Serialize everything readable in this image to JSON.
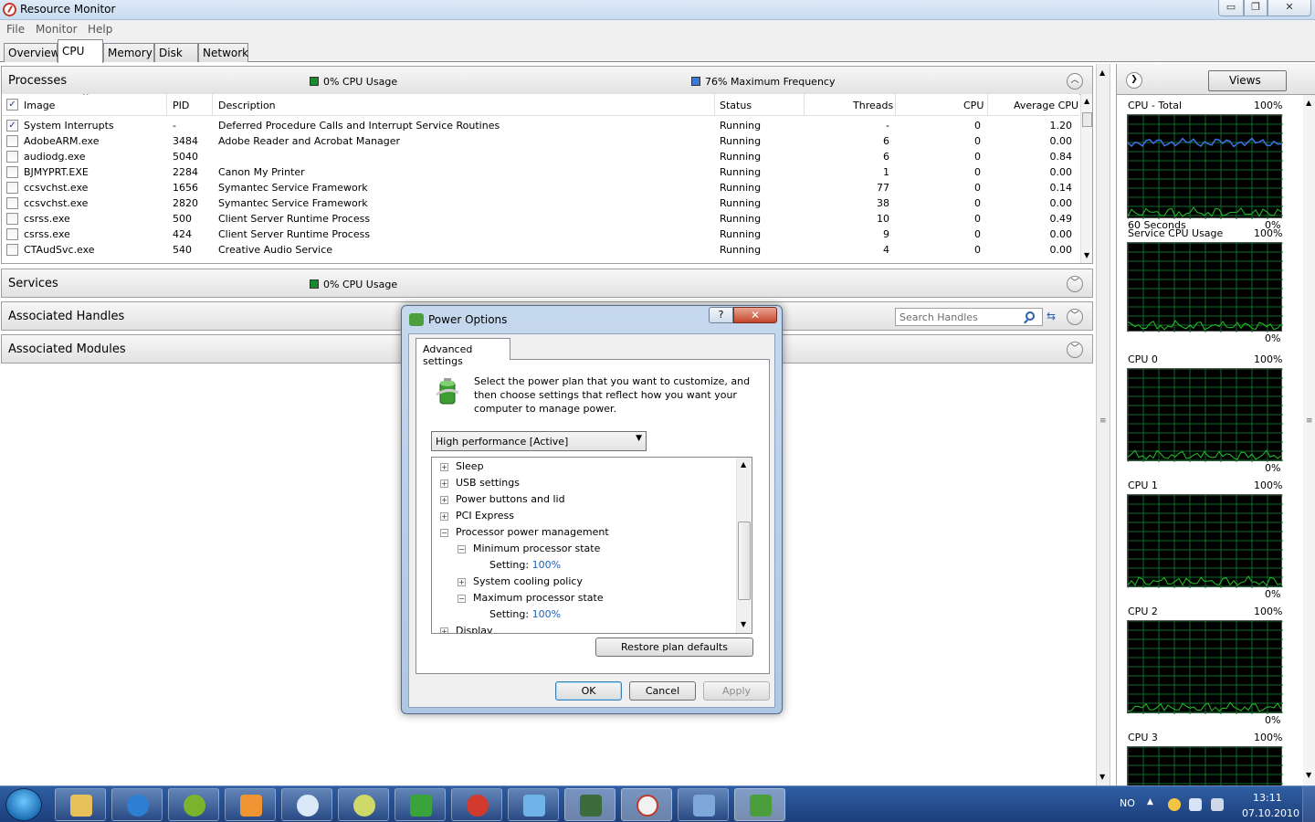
{
  "window": {
    "title": "Resource Monitor",
    "min": "▭",
    "max": "❐",
    "close": "✕"
  },
  "menu": [
    "File",
    "Monitor",
    "Help"
  ],
  "tabs": [
    "Overview",
    "CPU",
    "Memory",
    "Disk",
    "Network"
  ],
  "processes": {
    "title": "Processes",
    "cpu_usage": "0% CPU Usage",
    "max_freq": "76% Maximum Frequency",
    "columns": [
      "Image",
      "PID",
      "Description",
      "Status",
      "Threads",
      "CPU",
      "Average CPU"
    ],
    "rows": [
      {
        "checked": true,
        "image": "System Interrupts",
        "pid": "-",
        "desc": "Deferred Procedure Calls and Interrupt Service Routines",
        "status": "Running",
        "threads": "-",
        "cpu": "0",
        "avg": "1.20"
      },
      {
        "checked": false,
        "image": "AdobeARM.exe",
        "pid": "3484",
        "desc": "Adobe Reader and Acrobat Manager",
        "status": "Running",
        "threads": "6",
        "cpu": "0",
        "avg": "0.00"
      },
      {
        "checked": false,
        "image": "audiodg.exe",
        "pid": "5040",
        "desc": "",
        "status": "Running",
        "threads": "6",
        "cpu": "0",
        "avg": "0.84"
      },
      {
        "checked": false,
        "image": "BJMYPRT.EXE",
        "pid": "2284",
        "desc": "Canon My Printer",
        "status": "Running",
        "threads": "1",
        "cpu": "0",
        "avg": "0.00"
      },
      {
        "checked": false,
        "image": "ccsvchst.exe",
        "pid": "1656",
        "desc": "Symantec Service Framework",
        "status": "Running",
        "threads": "77",
        "cpu": "0",
        "avg": "0.14"
      },
      {
        "checked": false,
        "image": "ccsvchst.exe",
        "pid": "2820",
        "desc": "Symantec Service Framework",
        "status": "Running",
        "threads": "38",
        "cpu": "0",
        "avg": "0.00"
      },
      {
        "checked": false,
        "image": "csrss.exe",
        "pid": "500",
        "desc": "Client Server Runtime Process",
        "status": "Running",
        "threads": "10",
        "cpu": "0",
        "avg": "0.49"
      },
      {
        "checked": false,
        "image": "csrss.exe",
        "pid": "424",
        "desc": "Client Server Runtime Process",
        "status": "Running",
        "threads": "9",
        "cpu": "0",
        "avg": "0.00"
      },
      {
        "checked": false,
        "image": "CTAudSvc.exe",
        "pid": "540",
        "desc": "Creative Audio Service",
        "status": "Running",
        "threads": "4",
        "cpu": "0",
        "avg": "0.00"
      }
    ]
  },
  "services": {
    "title": "Services",
    "cpu_usage": "0% CPU Usage"
  },
  "handles": {
    "title": "Associated Handles",
    "search_placeholder": "Search Handles"
  },
  "modules": {
    "title": "Associated Modules"
  },
  "right_panel": {
    "views": "Views",
    "graphs": [
      {
        "label": "CPU - Total",
        "max": "100%",
        "bottom_left": "60 Seconds",
        "bottom_right": "0%"
      },
      {
        "label": "Service CPU Usage",
        "max": "100%",
        "bottom_left": "",
        "bottom_right": "0%"
      },
      {
        "label": "CPU 0",
        "max": "100%",
        "bottom_left": "",
        "bottom_right": "0%"
      },
      {
        "label": "CPU 1",
        "max": "100%",
        "bottom_left": "",
        "bottom_right": "0%"
      },
      {
        "label": "CPU 2",
        "max": "100%",
        "bottom_left": "",
        "bottom_right": "0%"
      },
      {
        "label": "CPU 3",
        "max": "100%",
        "bottom_left": "",
        "bottom_right": ""
      }
    ]
  },
  "dialog": {
    "title": "Power Options",
    "help": "?",
    "close": "✕",
    "tab": "Advanced settings",
    "description": "Select the power plan that you want to customize, and then choose settings that reflect how you want your computer to manage power.",
    "plan": "High performance [Active]",
    "tree": {
      "sleep": "Sleep",
      "usb": "USB settings",
      "power_buttons": "Power buttons and lid",
      "pci": "PCI Express",
      "processor": "Processor power management",
      "min_state": "Minimum processor state",
      "setting_label": "Setting:",
      "min_value": "100%",
      "cooling": "System cooling policy",
      "max_state": "Maximum processor state",
      "max_value": "100%",
      "display": "Display"
    },
    "restore": "Restore plan defaults",
    "ok": "OK",
    "cancel": "Cancel",
    "apply": "Apply"
  },
  "taskbar": {
    "lang": "NO",
    "time": "13:11",
    "date": "07.10.2010"
  },
  "colors": {
    "graph_green": "#29c22b",
    "graph_blue": "#3f6fe8",
    "grid": "#0d6d2a"
  }
}
